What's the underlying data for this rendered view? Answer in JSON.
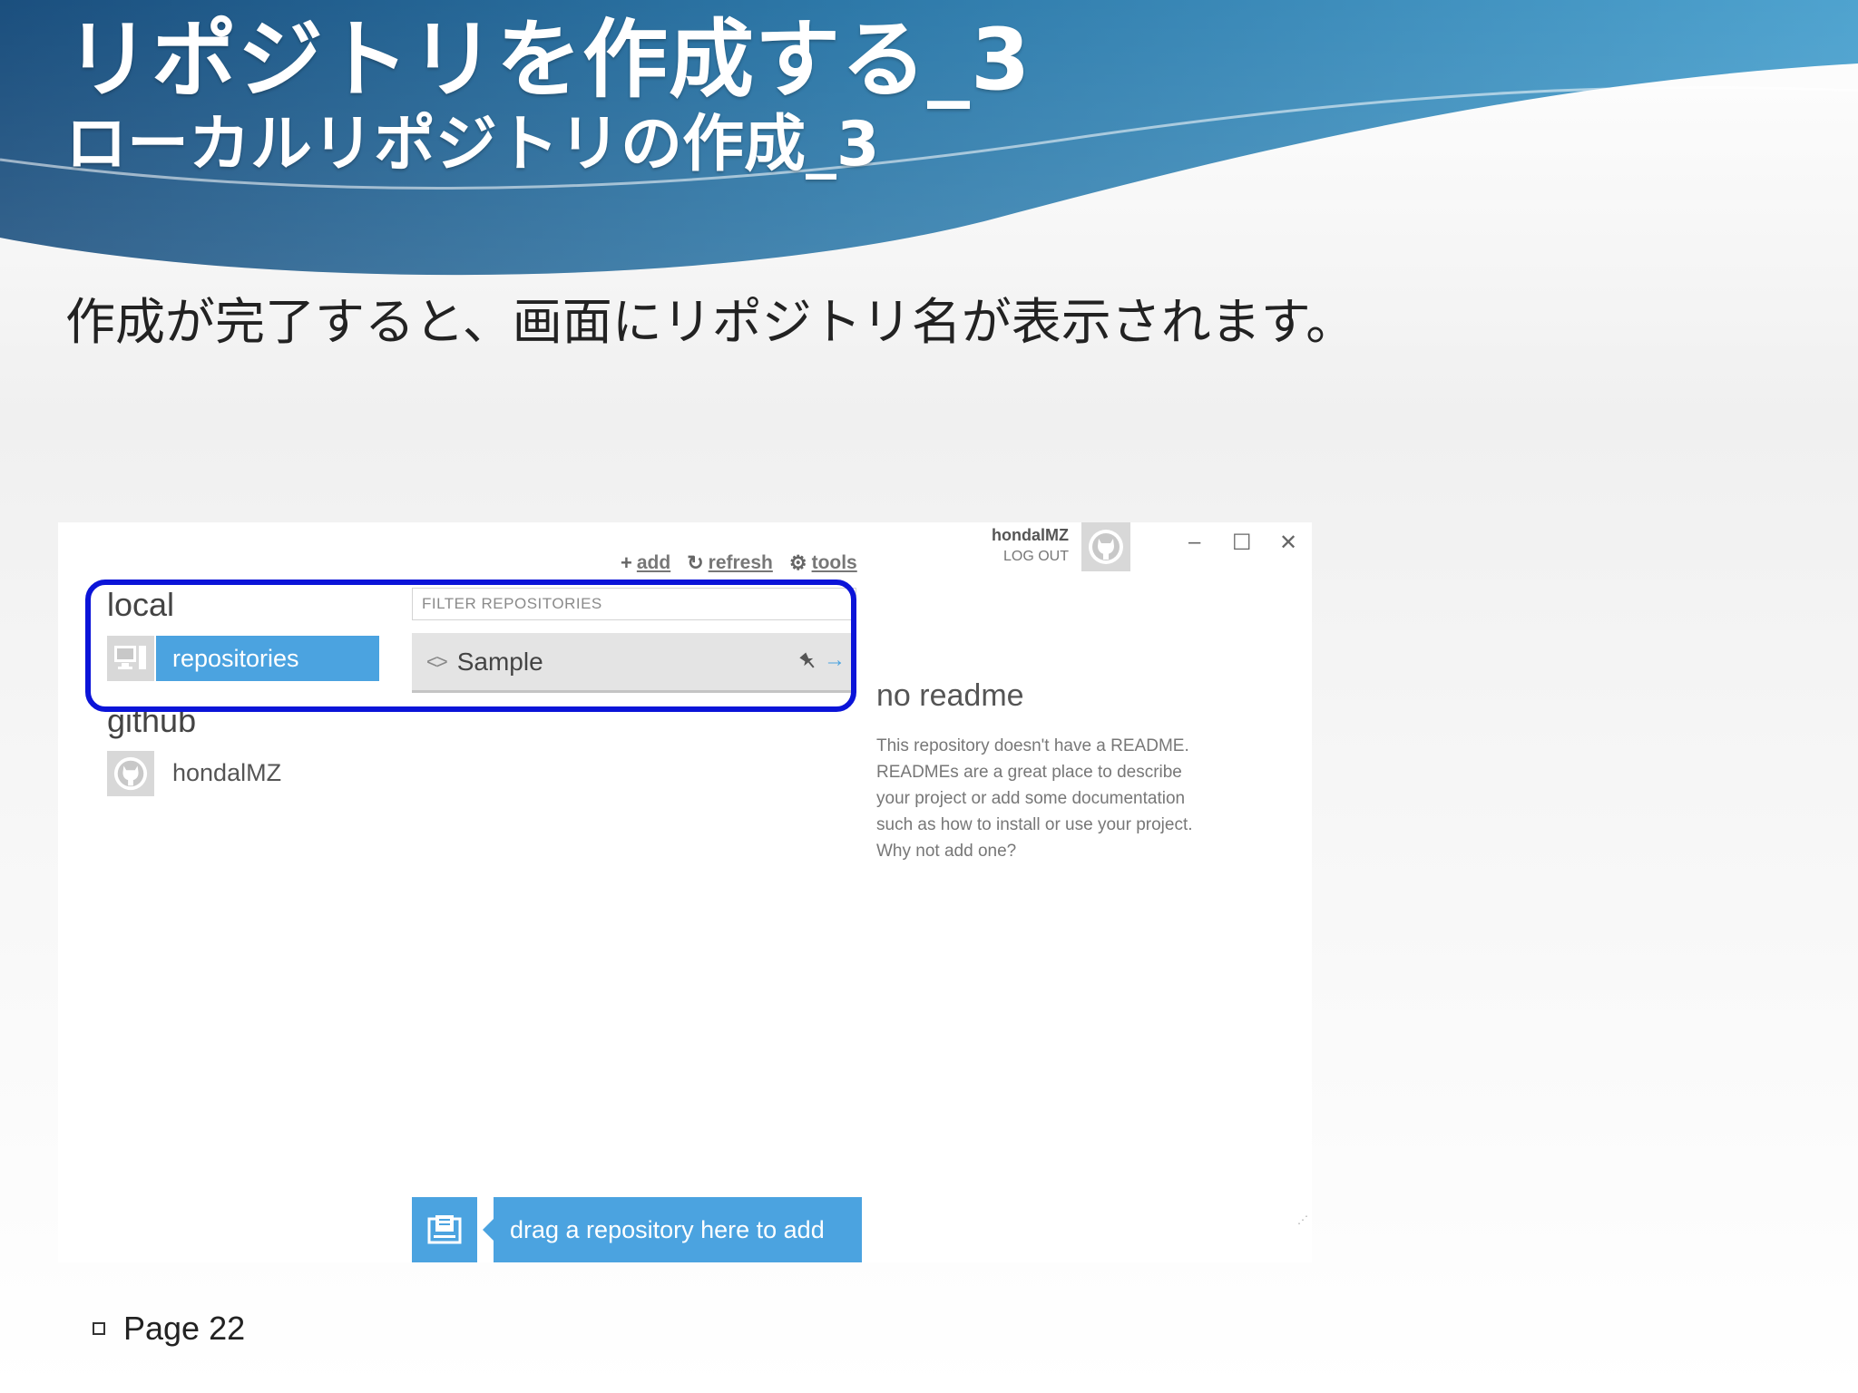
{
  "slide": {
    "title": "リポジトリを作成する_3",
    "subtitle": "ローカルリポジトリの作成_3",
    "body_text": "作成が完了すると、画面にリポジトリ名が表示されます。",
    "footer_page": "Page 22",
    "colors": {
      "banner_dark": "#1b4f7e",
      "banner_light": "#4a9cc8",
      "highlight": "#0b14d8"
    }
  },
  "app": {
    "toolbar": {
      "add": "add",
      "refresh": "refresh",
      "tools": "tools"
    },
    "user": {
      "name": "hondalMZ",
      "logout": "LOG OUT"
    },
    "window_buttons": {
      "minimize": "–",
      "maximize": "☐",
      "close": "✕"
    },
    "sidebar": {
      "local_header": "local",
      "local_item": "repositories",
      "github_header": "github",
      "github_item": "hondalMZ"
    },
    "filter_placeholder": "FILTER REPOSITORIES",
    "repositories": [
      {
        "name": "Sample"
      }
    ],
    "readme": {
      "title": "no readme",
      "text": "This repository doesn't have a README. READMEs are a great place to describe your project or add some documentation such as how to install or use your project. Why not add one?"
    },
    "drop_zone": "drag a repository here to add",
    "accent_color": "#4ba3e0"
  }
}
